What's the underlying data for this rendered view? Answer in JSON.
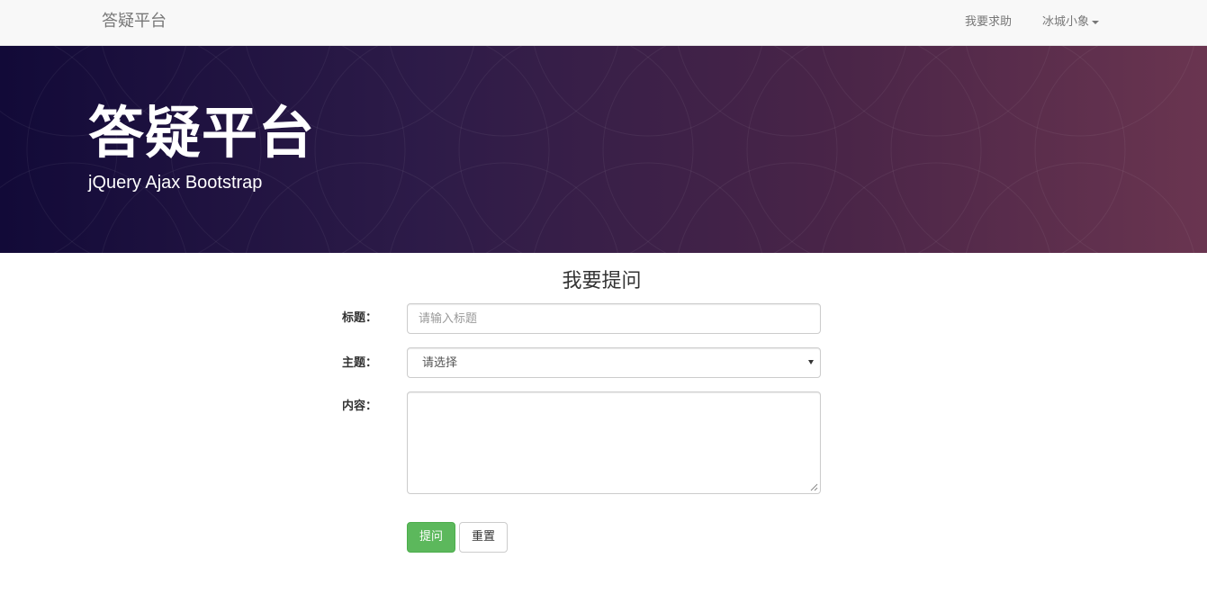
{
  "navbar": {
    "brand": "答疑平台",
    "help_link": "我要求助",
    "user_menu": "冰城小象"
  },
  "hero": {
    "title": "答疑平台",
    "subtitle": "jQuery Ajax Bootstrap"
  },
  "form": {
    "heading": "我要提问",
    "title_label": "标题：",
    "title_placeholder": "请输入标题",
    "topic_label": "主题：",
    "topic_selected": "请选择",
    "content_label": "内容：",
    "submit_label": "提问",
    "reset_label": "重置"
  },
  "colors": {
    "navbar_bg": "#f8f8f8",
    "hero_gradient_start": "#120a38",
    "hero_gradient_end": "#6a3550",
    "submit_green": "#5cb85c"
  },
  "icons": {
    "user_menu_caret": "caret-down-icon",
    "select_arrow": "chevron-down-icon",
    "textarea_resize": "resize-grip-icon"
  }
}
